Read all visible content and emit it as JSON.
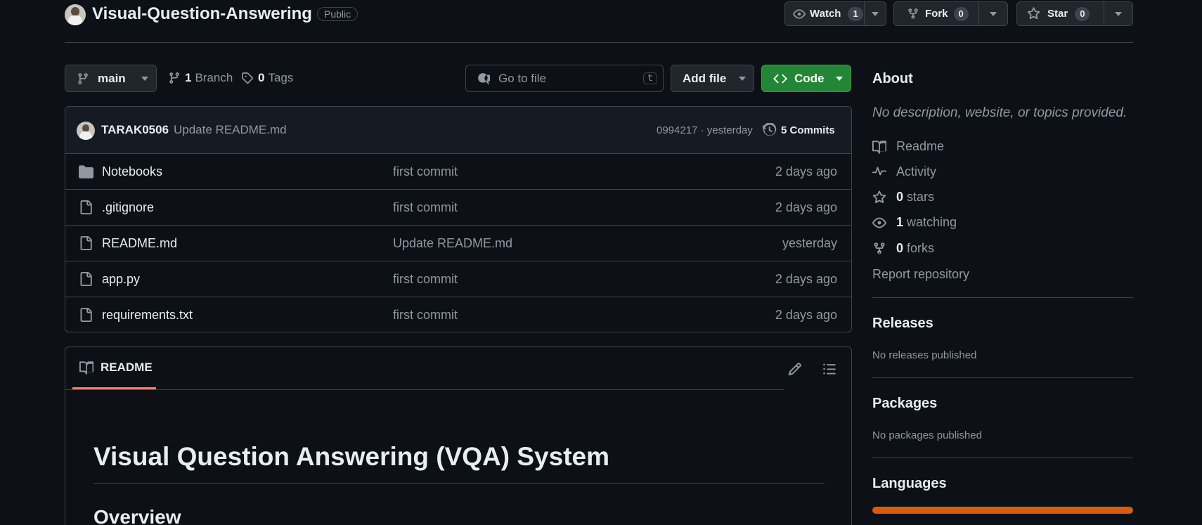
{
  "repo": {
    "name": "Visual-Question-Answering",
    "visibility": "Public"
  },
  "actions": {
    "watch_label": "Watch",
    "watch_count": "1",
    "fork_label": "Fork",
    "fork_count": "0",
    "star_label": "Star",
    "star_count": "0"
  },
  "toolbar": {
    "branch": "main",
    "branch_count": "1",
    "branch_label": "Branch",
    "tag_count": "0",
    "tag_label": "Tags",
    "search_placeholder": "Go to file",
    "search_shortcut": "t",
    "add_file_label": "Add file",
    "code_label": "Code"
  },
  "commit": {
    "author": "TARAK0506",
    "message": "Update README.md",
    "hash_time": "0994217 · yesterday",
    "commits_label": "5 Commits"
  },
  "files": [
    {
      "name": "Notebooks",
      "type": "folder",
      "message": "first commit",
      "age": "2 days ago"
    },
    {
      "name": ".gitignore",
      "type": "file",
      "message": "first commit",
      "age": "2 days ago"
    },
    {
      "name": "README.md",
      "type": "file",
      "message": "Update README.md",
      "age": "yesterday"
    },
    {
      "name": "app.py",
      "type": "file",
      "message": "first commit",
      "age": "2 days ago"
    },
    {
      "name": "requirements.txt",
      "type": "file",
      "message": "first commit",
      "age": "2 days ago"
    }
  ],
  "readme": {
    "tab_label": "README",
    "title": "Visual Question Answering (VQA) System",
    "section": "Overview"
  },
  "about": {
    "heading": "About",
    "description": "No description, website, or topics provided.",
    "readme_link": "Readme",
    "activity_link": "Activity",
    "stars_count": "0",
    "stars_label": "stars",
    "watching_count": "1",
    "watching_label": "watching",
    "forks_count": "0",
    "forks_label": "forks",
    "report_link": "Report repository"
  },
  "releases": {
    "heading": "Releases",
    "text": "No releases published"
  },
  "packages": {
    "heading": "Packages",
    "text": "No packages published"
  },
  "languages": {
    "heading": "Languages",
    "bar_color": "#da5b0b"
  },
  "colors": {
    "background": "#0d1117",
    "code_button": "#238636",
    "tab_underline": "#f78166"
  }
}
